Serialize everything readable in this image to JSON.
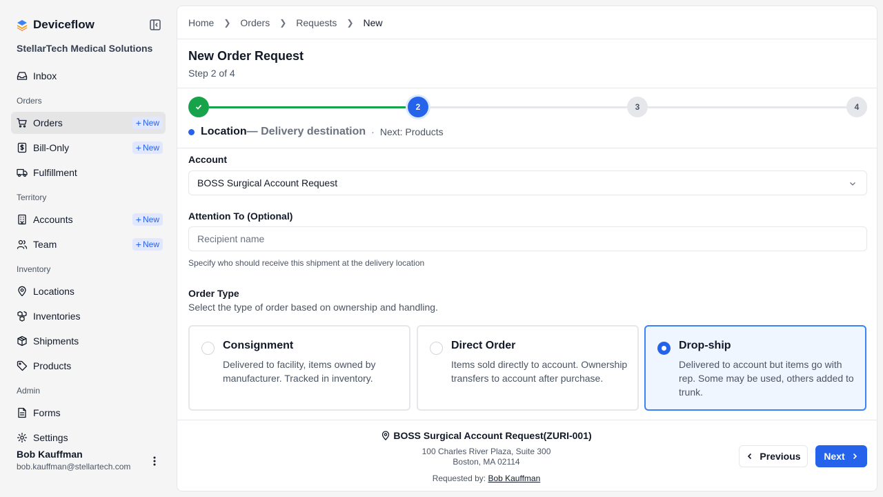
{
  "app": {
    "name": "Deviceflow",
    "org": "StellarTech Medical Solutions"
  },
  "sidebar": {
    "new_label": "New",
    "items": [
      {
        "type": "item",
        "label": "Inbox",
        "icon": "inbox-icon"
      },
      {
        "type": "section",
        "label": "Orders"
      },
      {
        "type": "item",
        "label": "Orders",
        "icon": "cart-icon",
        "active": true,
        "badge": true
      },
      {
        "type": "item",
        "label": "Bill-Only",
        "icon": "receipt-dollar-icon",
        "badge": true
      },
      {
        "type": "item",
        "label": "Fulfillment",
        "icon": "truck-icon"
      },
      {
        "type": "section",
        "label": "Territory"
      },
      {
        "type": "item",
        "label": "Accounts",
        "icon": "building-icon",
        "badge": true
      },
      {
        "type": "item",
        "label": "Team",
        "icon": "users-icon",
        "badge": true
      },
      {
        "type": "section",
        "label": "Inventory"
      },
      {
        "type": "item",
        "label": "Locations",
        "icon": "map-pin-icon"
      },
      {
        "type": "item",
        "label": "Inventories",
        "icon": "boxes-icon"
      },
      {
        "type": "item",
        "label": "Shipments",
        "icon": "package-icon"
      },
      {
        "type": "item",
        "label": "Products",
        "icon": "tag-icon"
      },
      {
        "type": "section",
        "label": "Admin"
      },
      {
        "type": "item",
        "label": "Forms",
        "icon": "document-icon"
      },
      {
        "type": "item",
        "label": "Settings",
        "icon": "gear-icon"
      }
    ]
  },
  "user": {
    "name": "Bob Kauffman",
    "email": "bob.kauffman@stellartech.com"
  },
  "breadcrumb": [
    "Home",
    "Orders",
    "Requests",
    "New"
  ],
  "page": {
    "title": "New Order Request",
    "subtitle": "Step 2 of 4"
  },
  "stepper": {
    "steps": [
      {
        "num": "1",
        "state": "done"
      },
      {
        "num": "2",
        "state": "current"
      },
      {
        "num": "3",
        "state": "todo"
      },
      {
        "num": "4",
        "state": "todo"
      }
    ],
    "current_name": "Location",
    "current_desc": "— Delivery destination",
    "next_label": "Next: Products"
  },
  "form": {
    "account_label": "Account",
    "account_value": "BOSS Surgical Account Request",
    "attention_label": "Attention To (Optional)",
    "attention_placeholder": "Recipient name",
    "attention_help": "Specify who should receive this shipment at the delivery location",
    "order_type_label": "Order Type",
    "order_type_sub": "Select the type of order based on ownership and handling.",
    "order_types": [
      {
        "title": "Consignment",
        "desc": "Delivered to facility, items owned by manufacturer. Tracked in inventory.",
        "selected": false
      },
      {
        "title": "Direct Order",
        "desc": "Items sold directly to account. Ownership transfers to account after purchase.",
        "selected": false
      },
      {
        "title": "Drop-ship",
        "desc": "Delivered to account but items go with rep. Some may be used, others added to trunk.",
        "selected": true
      }
    ]
  },
  "footer": {
    "address_title": "BOSS Surgical Account Request(ZURI-001)",
    "address_line1": "100 Charles River Plaza, Suite 300",
    "address_line2": "Boston, MA 02114",
    "requested_by_label": "Requested by:",
    "requested_by_name": "Bob Kauffman",
    "prev_label": "Previous",
    "next_label": "Next"
  },
  "colors": {
    "accent": "#2563eb",
    "success": "#16a34a",
    "selected_bg": "#eff6ff"
  }
}
